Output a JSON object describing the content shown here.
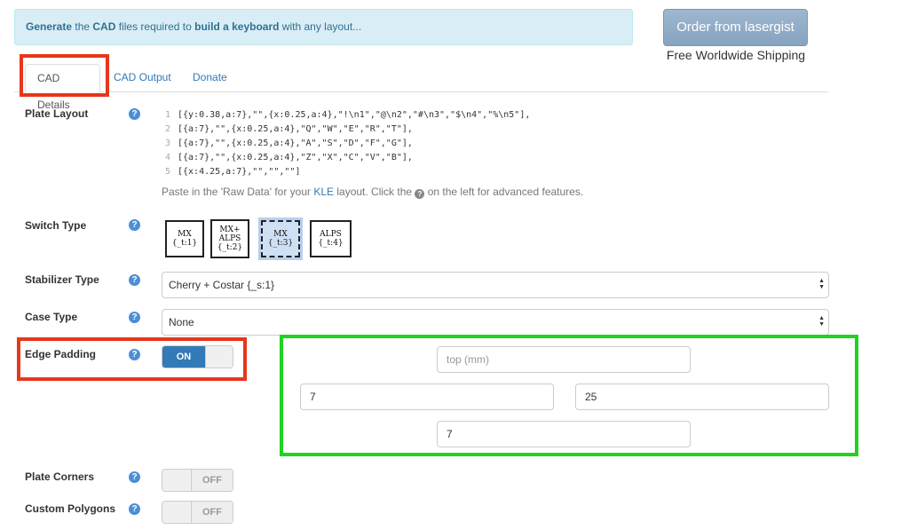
{
  "banner": {
    "w1": "Generate",
    "w2": " the ",
    "w3": "CAD",
    "w4": " files required to ",
    "w5": "build a keyboard",
    "w6": " with any layout..."
  },
  "order": {
    "label": "Order from lasergist",
    "shipping": "Free Worldwide Shipping"
  },
  "tabs": [
    {
      "label": "CAD Details"
    },
    {
      "label": "CAD Output"
    },
    {
      "label": "Donate"
    }
  ],
  "plate_layout": {
    "label": "Plate Layout",
    "lines": [
      {
        "num": "1",
        "text": "[{y:0.38,a:7},\"\",{x:0.25,a:4},\"!\\n1\",\"@\\n2\",\"#\\n3\",\"$\\n4\",\"%\\n5\"],"
      },
      {
        "num": "2",
        "text": "[{a:7},\"\",{x:0.25,a:4},\"Q\",\"W\",\"E\",\"R\",\"T\"],"
      },
      {
        "num": "3",
        "text": "[{a:7},\"\",{x:0.25,a:4},\"A\",\"S\",\"D\",\"F\",\"G\"],"
      },
      {
        "num": "4",
        "text": "[{a:7},\"\",{x:0.25,a:4},\"Z\",\"X\",\"C\",\"V\",\"B\"],"
      },
      {
        "num": "5",
        "text": "[{x:4.25,a:7},\"\",\"\",\"\"]"
      }
    ],
    "hint_pre": "Paste in the 'Raw Data' for your ",
    "hint_link": "KLE",
    "hint_mid": " layout. Click the ",
    "hint_post": " on the left for advanced features."
  },
  "switch_type": {
    "label": "Switch Type",
    "options": [
      {
        "l1": "MX",
        "l2": "{_t:1}"
      },
      {
        "l1": "MX+",
        "l2": "ALPS",
        "l3": "{_t:2}"
      },
      {
        "l1": "MX",
        "l2": "{_t:3}"
      },
      {
        "l1": "ALPS",
        "l2": "{_t:4}"
      }
    ]
  },
  "stabilizer": {
    "label": "Stabilizer Type",
    "value": "Cherry + Costar {_s:1}"
  },
  "case_type": {
    "label": "Case Type",
    "value": "None"
  },
  "edge_padding": {
    "label": "Edge Padding",
    "state": "ON",
    "top_placeholder": "top (mm)",
    "left_value": "7",
    "right_value": "25",
    "bottom_value": "7"
  },
  "plate_corners": {
    "label": "Plate Corners",
    "state": "OFF"
  },
  "custom_polygons": {
    "label": "Custom Polygons",
    "state": "OFF"
  },
  "icons": {
    "help": "question-circle-icon",
    "select": "up-down-arrow-icon"
  },
  "colors": {
    "primary": "#337ab7",
    "highlight_red": "#e8361c",
    "highlight_green": "#1fd31f"
  }
}
